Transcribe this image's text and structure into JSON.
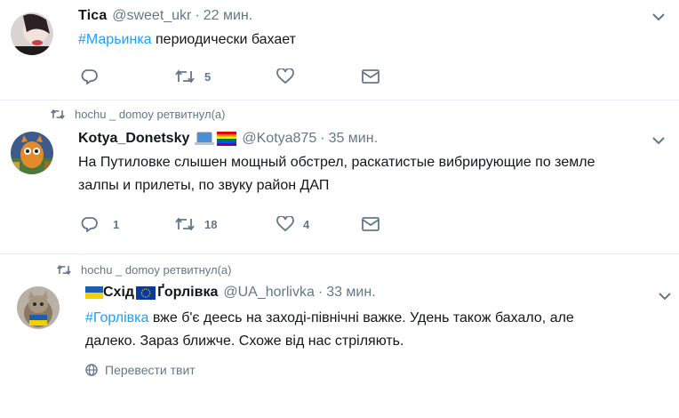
{
  "tweets": [
    {
      "name": "Tіса",
      "handle": "@sweet_ukr",
      "separator": "·",
      "time": "22 мин.",
      "hashtag": "#Марьинка",
      "text": " периодически бахает",
      "retweet_count": "5"
    },
    {
      "retweeted_by": "hochu _ domoy ретвитнул(а)",
      "name": "Kotya_Donetsky",
      "handle": "@Kotya875",
      "separator": "·",
      "time": "35 мин.",
      "text_line1": "На Путиловке слышен мощный обстрел, раскатистые вибрирующие по земле",
      "text_line2": "залпы и прилеты, по звуку район ДАП",
      "reply_count": "1",
      "retweet_count": "18",
      "like_count": "4"
    },
    {
      "retweeted_by": "hochu _ domoy ретвитнул(а)",
      "name_part1": "Схід",
      "name_part2": "Ґорлівка",
      "handle": "@UA_horlivka",
      "separator": "·",
      "time": "33 мин.",
      "hashtag": "#Горлівка",
      "text_line1": " вже б'є деесь на заході-північні важке. Удень також бахало, але",
      "text_line2": "далеко. Зараз ближче. Схоже від нас стріляють.",
      "translate_label": "Перевести твит"
    }
  ],
  "colors": {
    "accent": "#1da1f2",
    "muted": "#657786",
    "text": "#14171a",
    "border": "#e6ecf0"
  }
}
